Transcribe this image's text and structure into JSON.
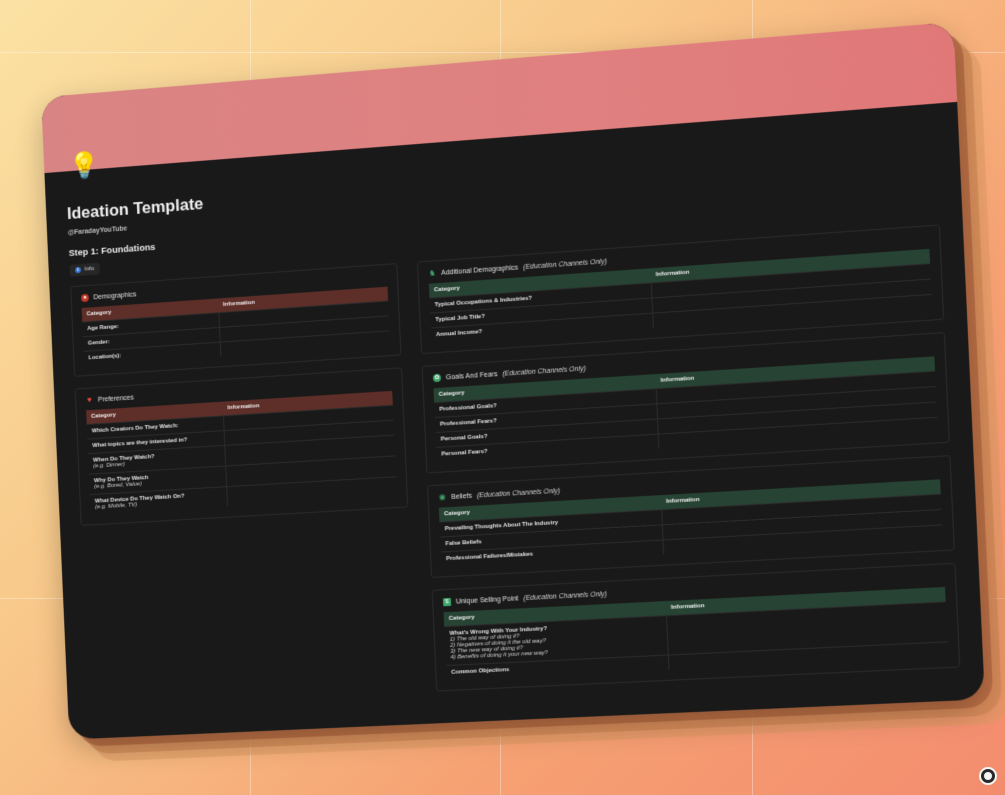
{
  "page": {
    "title": "Ideation Template",
    "handle": "@FaradayYouTube",
    "step_title": "Step 1: Foundations",
    "info_label": "Info"
  },
  "demographics": {
    "title": "Demographics",
    "columns": [
      "Category",
      "Information"
    ],
    "rows": [
      {
        "category": "Age Range:",
        "note": "",
        "info": ""
      },
      {
        "category": "Gender:",
        "note": "",
        "info": ""
      },
      {
        "category": "Location(s):",
        "note": "",
        "info": ""
      }
    ]
  },
  "preferences": {
    "title": "Preferences",
    "columns": [
      "Category",
      "Information"
    ],
    "rows": [
      {
        "category": "Which Creators Do They Watch:",
        "note": "",
        "info": ""
      },
      {
        "category": "What topics are they interested in?",
        "note": "",
        "info": ""
      },
      {
        "category": "When Do They Watch?",
        "note": "(e.g. Dinner)",
        "info": ""
      },
      {
        "category": "Why Do They Watch",
        "note": "(e.g. Bored, Value)",
        "info": ""
      },
      {
        "category": "What Device Do They Watch On?",
        "note": "(e.g. Mobile, TV)",
        "info": ""
      }
    ]
  },
  "additional_demographics": {
    "title": "Additional Demographics",
    "qualifier": "(Education Channels Only)",
    "columns": [
      "Category",
      "Information"
    ],
    "rows": [
      {
        "category": "Typical Occupations & Industries?",
        "info": ""
      },
      {
        "category": "Typical Job Title?",
        "info": ""
      },
      {
        "category": "Annual Income?",
        "info": ""
      }
    ]
  },
  "goals_fears": {
    "title": "Goals And Fears",
    "qualifier": "(Education Channels Only)",
    "columns": [
      "Category",
      "Information"
    ],
    "rows": [
      {
        "category": "Professional Goals?",
        "info": ""
      },
      {
        "category": "Professional Fears?",
        "info": ""
      },
      {
        "category": "Personal Goals?",
        "info": ""
      },
      {
        "category": "Personal Fears?",
        "info": ""
      }
    ]
  },
  "beliefs": {
    "title": "Beliefs",
    "qualifier": "(Education Channels Only)",
    "columns": [
      "Category",
      "Information"
    ],
    "rows": [
      {
        "category": "Prevailing Thoughts About The Industry",
        "info": ""
      },
      {
        "category": "False Beliefs",
        "info": ""
      },
      {
        "category": "Professional Failures/Mistakes",
        "info": ""
      }
    ]
  },
  "usp": {
    "title": "Unique Selling Point",
    "qualifier": "(Education Channels Only)",
    "columns": [
      "Category",
      "Information"
    ],
    "rows": [
      {
        "category": "What's Wrong With Your Industry?",
        "lines": [
          "1) The old way of doing it?",
          "2) Negatives of doing it the old way?",
          "3) The new way of doing it?",
          "4) Benefits of doing it your new way?"
        ],
        "info": ""
      },
      {
        "category": "Common Objections",
        "lines": [],
        "info": ""
      }
    ]
  },
  "colors": {
    "banner": "#d98484",
    "red_header": "#5e2e28",
    "green_header": "#264333",
    "canvas": "#191919"
  },
  "icons": {
    "page": "lightbulb-icon",
    "demographics": "person-circle-icon",
    "preferences": "heart-icon",
    "additional_demographics": "chess-knight-icon",
    "goals_fears": "brain-icon",
    "beliefs": "map-pin-icon",
    "usp": "money-bill-icon"
  }
}
